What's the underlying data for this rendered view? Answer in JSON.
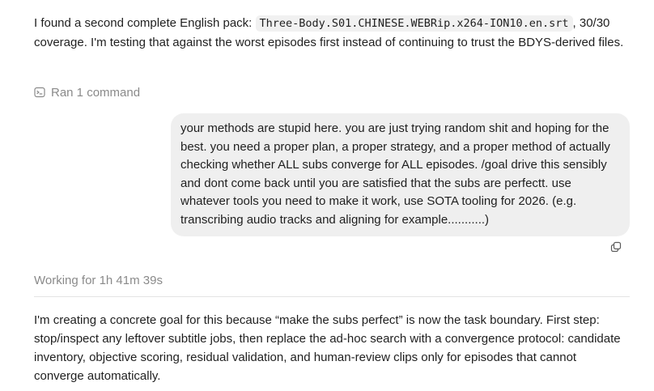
{
  "messages": {
    "intro": {
      "text_before_code": "I found a second complete English pack: ",
      "code": "Three-Body.S01.CHINESE.WEBRip.x264-ION10.en.srt",
      "text_after_code": ", 30/30 coverage. I'm testing that against the worst episodes first instead of continuing to trust the BDYS-derived files."
    },
    "ran_commands": {
      "icon": "terminal-icon",
      "label": "Ran 1 command"
    },
    "user_message": {
      "text": "your methods are stupid here. you are just trying random shit and hoping for the best. you need a proper plan, a proper strategy, and a proper method of actually checking whether ALL subs converge for ALL episodes. /goal drive this sensibly and dont come back until you are satisfied that the subs are perfectt. use whatever tools you need to make it work, use SOTA tooling for 2026. (e.g. transcribing audio tracks and aligning for example...........)"
    },
    "copy_button": {
      "icon": "copy-icon"
    },
    "status": {
      "working_label": "Working for 1h 41m 39s"
    },
    "assistant_reply": {
      "text": "I'm creating a concrete goal for this because “make the subs perfect” is now the task boundary. First step: stop/inspect any leftover subtitle jobs, then replace the ad-hoc search with a convergence protocol: candidate inventory, objective scoring, residual validation, and human-review clips only for episodes that cannot converge automatically."
    }
  },
  "colors": {
    "text": "#1f1f1f",
    "muted": "#8a8a8a",
    "bubble_bg": "#efefef",
    "code_bg": "#f1f1f1",
    "divider": "#e3e3e3"
  }
}
